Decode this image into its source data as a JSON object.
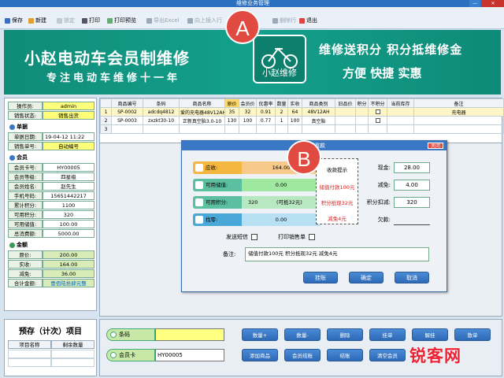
{
  "window": {
    "title": "维修业务管理"
  },
  "toolbar": {
    "save": "保存",
    "new": "新建",
    "lock": "锁定",
    "print": "打印",
    "print_preview": "打印预览",
    "export_excel": "导出Excel",
    "insert_row": "向上插入行",
    "delete_row": "删除行",
    "exit": "退出"
  },
  "banner": {
    "title": "小赵电动车会员制维修",
    "subtitle": "专注电动车维修十一年",
    "logo_text": "小赵维修",
    "slogan1": "维修送积分  积分抵维修金",
    "slogan2": "方便  快捷  实惠"
  },
  "annotations": {
    "a": "A",
    "b": "B"
  },
  "left": {
    "operator_label": "操作员:",
    "operator": "admin",
    "status_label": "销售状态:",
    "status": "销售出货",
    "section_doc": "单据",
    "date_label": "单据日期:",
    "date": "19-04-12 11:22",
    "sale_no_label": "销售单号:",
    "sale_no": "自动编号",
    "section_member": "会员",
    "card_label": "会员卡号:",
    "card": "HY00005",
    "level_label": "会员等级:",
    "level": "四星级",
    "name_label": "会员姓名:",
    "name": "赵先生",
    "phone_label": "手机号码:",
    "phone": "15651442217",
    "acc_points_label": "累计积分:",
    "acc_points": "1100",
    "avail_points_label": "可用积分:",
    "avail_points": "320",
    "avail_stored_label": "可用储值:",
    "avail_stored": "100.00",
    "total_spend_label": "总消费额:",
    "total_spend": "5000.00",
    "section_amount": "金额",
    "orig_label": "原价:",
    "orig": "200.00",
    "received_label": "实收:",
    "received": "164.00",
    "discount_label": "减免:",
    "discount": "36.00",
    "total_label": "合计金额:",
    "total": "壹佰陆拾肆元整"
  },
  "grid": {
    "headers": [
      "商品编号",
      "条码",
      "商品名称",
      "原价",
      "会员价",
      "优惠率",
      "数量",
      "实收",
      "商品类别",
      "旧品价",
      "积分",
      "不积分",
      "当前库存",
      "备注"
    ],
    "rows": [
      {
        "n": "1",
        "code": "SP-0002",
        "barcode": "adcdq4812",
        "name": "爱的充电器48V12AH",
        "orig": "35",
        "mem": "32",
        "rate": "0.91",
        "qty": "2",
        "recv": "64",
        "cat": "48V12AH",
        "old": "",
        "pts": "",
        "nopts": "",
        "stock": "",
        "remark": "充电器"
      },
      {
        "n": "2",
        "code": "SP-0003",
        "barcode": "zxzkt30-10",
        "name": "正新真空胎3.0-10",
        "orig": "130",
        "mem": "100",
        "rate": "0.77",
        "qty": "1",
        "recv": "100",
        "cat": "真空胎",
        "old": "",
        "pts": "",
        "nopts": "",
        "stock": "",
        "remark": ""
      },
      {
        "n": "3",
        "code": "",
        "barcode": "",
        "name": "",
        "orig": "",
        "mem": "",
        "rate": "",
        "qty": "",
        "recv": "",
        "cat": "",
        "old": "",
        "pts": "",
        "nopts": "",
        "stock": "",
        "remark": ""
      }
    ]
  },
  "dialog": {
    "title": "结账收款",
    "close": "关闭",
    "receivable_label": "应收:",
    "receivable": "164.00",
    "stored_label": "可用储值:",
    "stored": "0.00",
    "points_label": "可用积分:",
    "points": "320",
    "points_deduct": "(可抵32元)",
    "change_label": "找零:",
    "change": "0.00",
    "hint_title": "收款提示",
    "hint1": "储值付款100元",
    "hint2": "积分抵现32元",
    "hint3": "减免4元",
    "cash_label": "现金:",
    "cash": "28.00",
    "discount_label": "减免:",
    "discount": "4.00",
    "points_ded_label": "积分扣减:",
    "points_ded": "320",
    "owed_label": "欠款:",
    "owed": "",
    "sms_label": "发送短信",
    "print_label": "打印销售单",
    "note_label": "备注:",
    "note": "储值付款100元 积分抵现32元 减免4元",
    "btn_hold": "挂账",
    "btn_ok": "确定",
    "btn_cancel": "取消"
  },
  "bottom_left": {
    "title": "预存（计次）项目",
    "col1": "项目名称",
    "col2": "剩余数量"
  },
  "bottom": {
    "barcode_label": "条码",
    "barcode": "",
    "card_label": "会员卡",
    "card": "HY00005",
    "btns_row1": [
      "数量+",
      "数量-",
      "删除",
      "挂单",
      "解挂",
      "散单"
    ],
    "btns_row2": [
      "添加商品",
      "会员结账",
      "结账",
      "清空会员",
      "",
      ""
    ]
  },
  "watermark": "锐客网",
  "colors": {
    "accent": "#2d69b6",
    "banner": "#13a08b",
    "badge": "#e04a40"
  }
}
